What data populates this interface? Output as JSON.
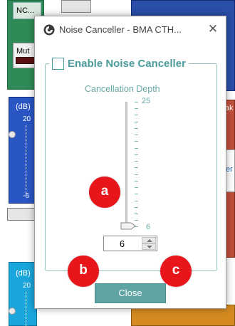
{
  "background": {
    "nc_button_label": "NC...",
    "mute_button_label": "Mut",
    "left_panel_unit": "(dB)",
    "left_panel_top_value": "20",
    "left_panel_bottom_value": "-6",
    "cyan_panel_unit": "(dB)",
    "cyan_panel_top_value": "20",
    "right_panel_partial_text": "ak",
    "right_panel_inner_partial_text": "er"
  },
  "dialog": {
    "title": "Noise Canceller - BMA CTH...",
    "close_glyph": "✕",
    "enable_label": "Enable Noise Canceller",
    "enable_checked": false,
    "depth_label": "Cancellation Depth",
    "slider_max": "25",
    "slider_min": "6",
    "slider_value_fraction": 0,
    "spin_value": "6",
    "close_button_label": "Close"
  },
  "annotations": {
    "a": "a",
    "b": "b",
    "c": "c"
  },
  "colors": {
    "accent_teal": "#5fa3a3",
    "marker_red": "#e8151b"
  },
  "icons": {
    "title_icon": "app-logo-icon",
    "close_icon": "close-icon"
  }
}
